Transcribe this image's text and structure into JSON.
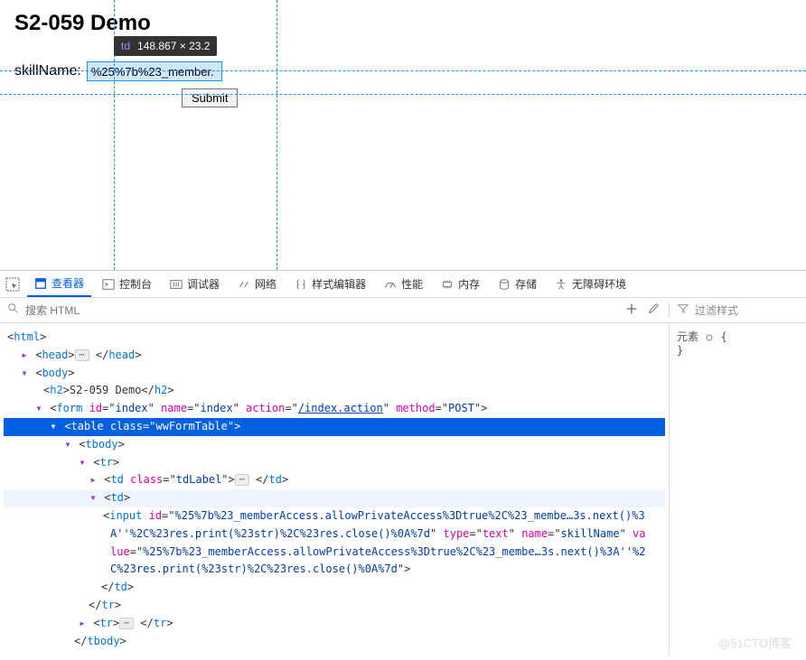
{
  "page": {
    "heading": "S2-059 Demo",
    "label": "skillName:",
    "inputValue": "%25%7b%23_member.",
    "submit": "Submit"
  },
  "tooltip": {
    "tag": "td",
    "dims": "148.867 × 23.2"
  },
  "tabs": {
    "inspector": "查看器",
    "console": "控制台",
    "debugger": "调试器",
    "network": "网络",
    "styleeditor": "样式编辑器",
    "performance": "性能",
    "memory": "内存",
    "storage": "存储",
    "accessibility": "无障碍环境"
  },
  "search": {
    "placeholder": "搜索 HTML"
  },
  "filter": {
    "placeholder": "过滤样式"
  },
  "styles": {
    "header": "元素",
    "brace_open": "{",
    "brace_close": "}"
  },
  "dom": {
    "html": "html",
    "head": "head",
    "body": "body",
    "h2": "h2",
    "h2_text": "S2-059 Demo",
    "form": "form",
    "form_id_n": "id",
    "form_id_v": "index",
    "form_name_n": "name",
    "form_name_v": "index",
    "form_action_n": "action",
    "form_action_v": "/index.action",
    "form_method_n": "method",
    "form_method_v": "POST",
    "table": "table",
    "table_class_n": "class",
    "table_class_v": "wwFormTable",
    "tbody": "tbody",
    "tr": "tr",
    "td": "td",
    "td_class_n": "class",
    "td_class_v": "tdLabel",
    "input": "input",
    "input_id_n": "id",
    "input_id_v": "%25%7b%23_memberAccess.allowPrivateAccess%3Dtrue%2C%23_membe…3s.next()%3A''%2C%23res.print(%23str)%2C%23res.close()%0A%7d",
    "input_type_n": "type",
    "input_type_v": "text",
    "input_name_n": "name",
    "input_name_v": "skillName",
    "input_value_n": "value",
    "input_value_v": "%25%7b%23_memberAccess.allowPrivateAccess%3Dtrue%2C%23_membe…3s.next()%3A''%2C%23res.print(%23str)%2C%23res.close()%0A%7d"
  },
  "watermark": "@51CTO博客"
}
